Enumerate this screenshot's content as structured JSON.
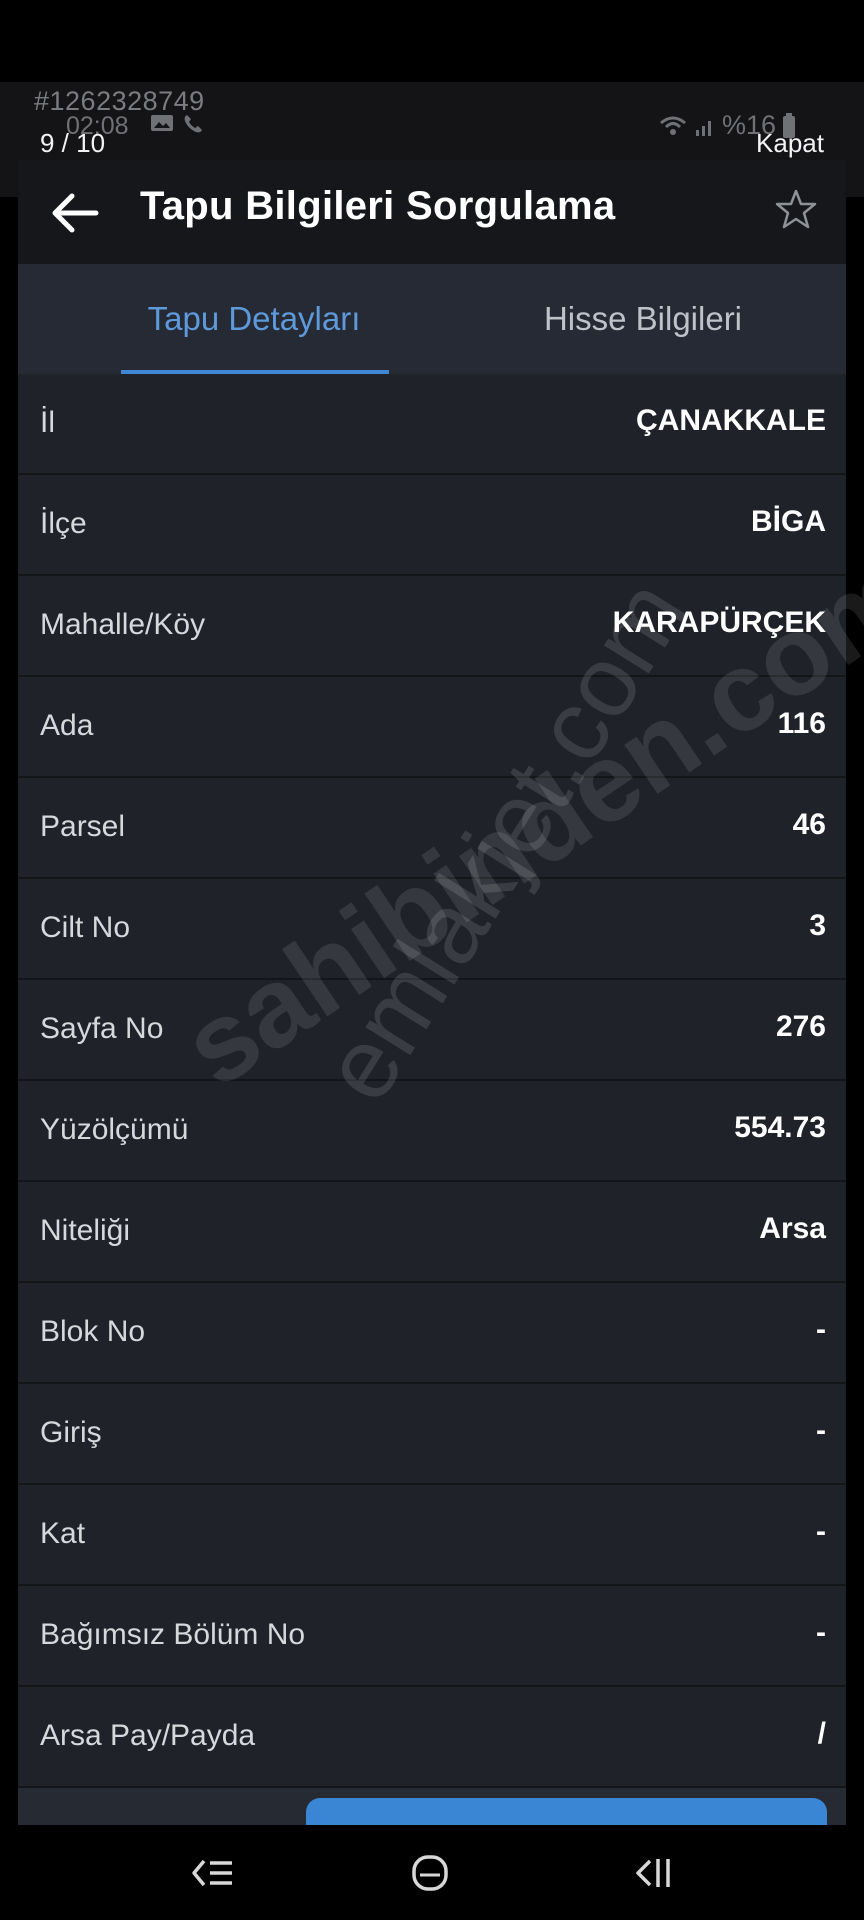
{
  "overlay": {
    "image_id": "#1262328749",
    "status_time": "02:08",
    "battery_text": "%16",
    "page_counter": "9 / 10",
    "close_label": "Kapat"
  },
  "header": {
    "title": "Tapu Bilgileri Sorgulama"
  },
  "tabs": [
    {
      "label": "Tapu Detayları",
      "active": true
    },
    {
      "label": "Hisse Bilgileri",
      "active": false
    }
  ],
  "rows": [
    {
      "label": "İl",
      "value": "ÇANAKKALE"
    },
    {
      "label": "İlçe",
      "value": "BİGA"
    },
    {
      "label": "Mahalle/Köy",
      "value": "KARAPÜRÇEK"
    },
    {
      "label": "Ada",
      "value": "116"
    },
    {
      "label": "Parsel",
      "value": "46"
    },
    {
      "label": "Cilt No",
      "value": "3"
    },
    {
      "label": "Sayfa No",
      "value": "276"
    },
    {
      "label": "Yüzölçümü",
      "value": "554.73"
    },
    {
      "label": "Niteliği",
      "value": "Arsa"
    },
    {
      "label": "Blok No",
      "value": "-"
    },
    {
      "label": "Giriş",
      "value": "-"
    },
    {
      "label": "Kat",
      "value": "-"
    },
    {
      "label": "Bağımsız Bölüm No",
      "value": "-"
    },
    {
      "label": "Arsa Pay/Payda",
      "value": "/"
    }
  ],
  "watermarks": {
    "sahibinden": "sahibinden.com",
    "emlakjet": "emlakjet.com"
  },
  "colors": {
    "accent": "#3f86d4",
    "background": "#1f2229",
    "header": "#15171b"
  }
}
